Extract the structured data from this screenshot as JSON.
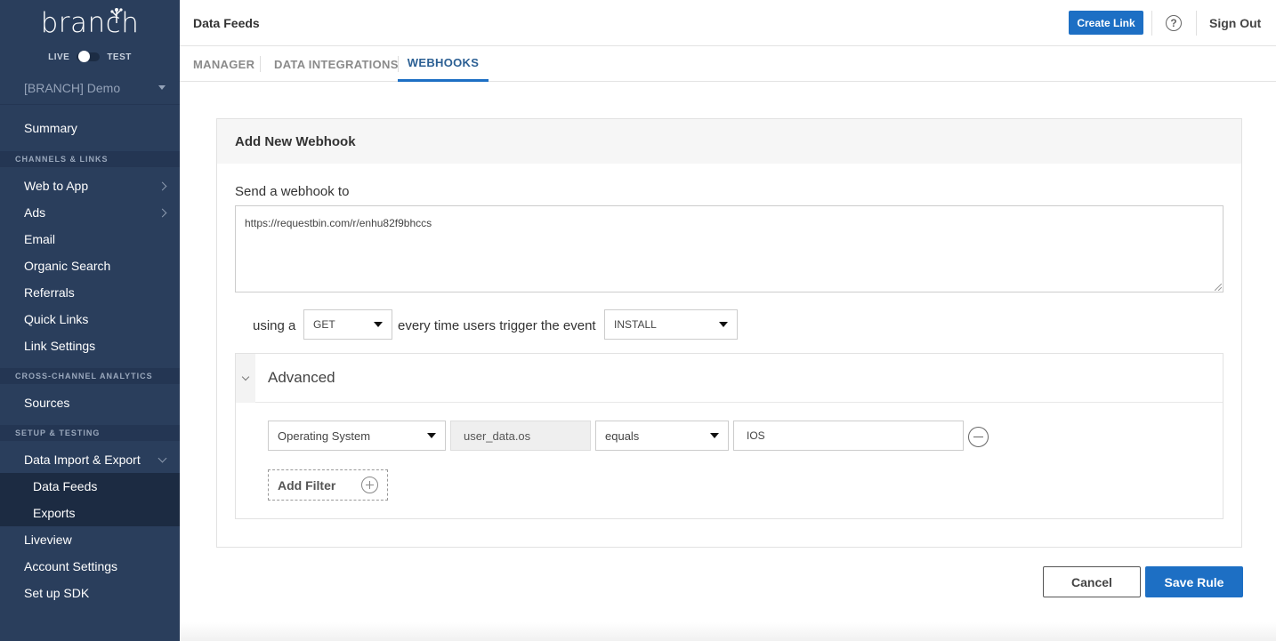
{
  "sidebar": {
    "brand": "branch",
    "env_live": "LIVE",
    "env_test": "TEST",
    "org": "[BRANCH] Demo",
    "summary": "Summary",
    "section_channels": "CHANNELS & LINKS",
    "channels": [
      {
        "label": "Web to App",
        "chevron": true
      },
      {
        "label": "Ads",
        "chevron": true
      },
      {
        "label": "Email"
      },
      {
        "label": "Organic Search"
      },
      {
        "label": "Referrals"
      },
      {
        "label": "Quick Links"
      },
      {
        "label": "Link Settings"
      }
    ],
    "section_analytics": "CROSS-CHANNEL ANALYTICS",
    "sources": "Sources",
    "section_setup": "SETUP & TESTING",
    "data_import_export": "Data Import & Export",
    "data_feeds": "Data Feeds",
    "exports": "Exports",
    "liveview": "Liveview",
    "account_settings": "Account Settings",
    "setup_sdk": "Set up SDK"
  },
  "header": {
    "title": "Data Feeds",
    "create_link": "Create Link",
    "help": "?",
    "sign_out": "Sign Out"
  },
  "tabs": [
    "MANAGER",
    "DATA INTEGRATIONS",
    "WEBHOOKS"
  ],
  "active_tab": "WEBHOOKS",
  "form": {
    "title": "Add New Webhook",
    "send_label": "Send a webhook to",
    "url": "https://requestbin.com/r/enhu82f9bhccs",
    "using_label": "using a",
    "method": "GET",
    "every_label": "every time users trigger the event",
    "event": "INSTALL",
    "advanced_title": "Advanced",
    "filter": {
      "field": "Operating System",
      "key": "user_data.os",
      "operator": "equals",
      "value": "IOS"
    },
    "add_filter": "Add Filter"
  },
  "actions": {
    "cancel": "Cancel",
    "save": "Save Rule"
  },
  "colors": {
    "sidebar_bg": "#2a3e5c",
    "primary": "#1d6fc4"
  }
}
